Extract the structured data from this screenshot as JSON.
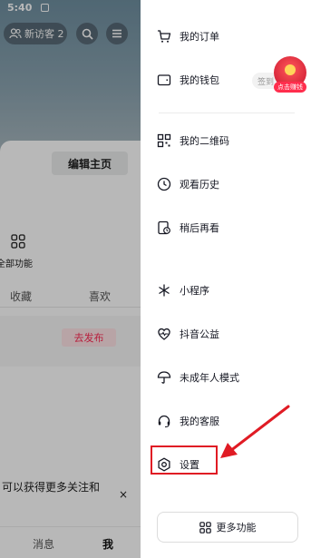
{
  "status_bar": {
    "time": "5:40"
  },
  "background": {
    "visitor_label": "新访客 2",
    "edit_profile": "编辑主页",
    "all_functions": "全部功能",
    "tabs": [
      "收藏",
      "喜欢"
    ],
    "publish_button": "去发布",
    "promo_text": "可以获得更多关注和",
    "promo_close": "×",
    "bottom_nav": [
      "消息",
      "我"
    ]
  },
  "drawer": {
    "items": [
      {
        "label": "我的订单",
        "icon": "cart-icon"
      },
      {
        "label": "我的钱包",
        "icon": "wallet-icon"
      },
      {
        "label": "我的二维码",
        "icon": "qrcode-icon"
      },
      {
        "label": "观看历史",
        "icon": "clock-icon"
      },
      {
        "label": "稍后再看",
        "icon": "watch-later-icon"
      },
      {
        "label": "小程序",
        "icon": "miniprogram-icon"
      },
      {
        "label": "抖音公益",
        "icon": "charity-icon"
      },
      {
        "label": "未成年人模式",
        "icon": "umbrella-icon"
      },
      {
        "label": "我的客服",
        "icon": "headset-icon"
      },
      {
        "label": "设置",
        "icon": "gear-icon"
      }
    ],
    "signin_label": "签到",
    "redpacket_label": "点击赚钱",
    "more_functions": "更多功能"
  },
  "colors": {
    "accent": "#fe2c55",
    "annotation": "#e01b24"
  }
}
